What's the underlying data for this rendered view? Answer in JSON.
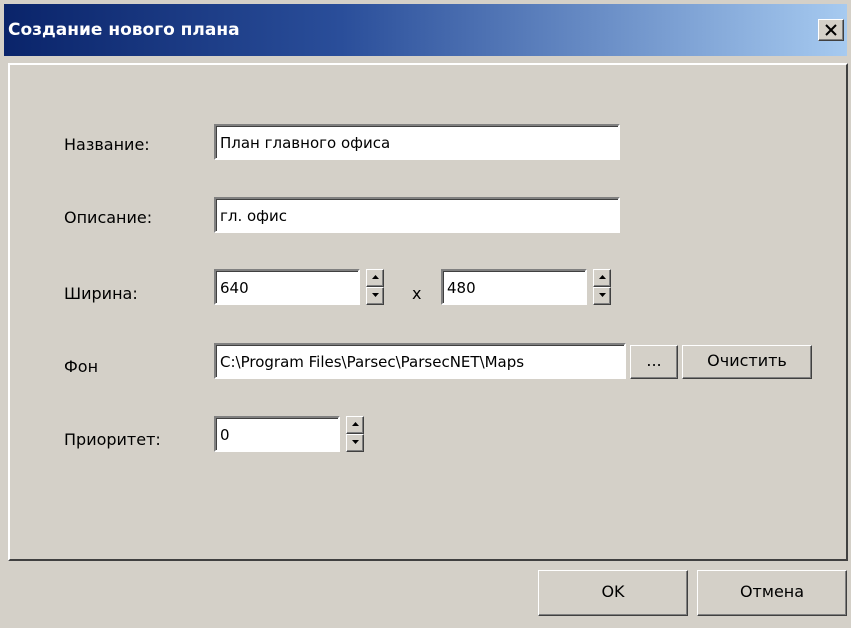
{
  "window": {
    "title": "Создание нового плана"
  },
  "form": {
    "name_label": "Название:",
    "name_value": "План главного офиса",
    "description_label": "Описание:",
    "description_value": "гл. офис",
    "width_label": "Ширина:",
    "width_value": "640",
    "separator": "x",
    "height_value": "480",
    "background_label": "Фон",
    "background_value": "C:\\Program Files\\Parsec\\ParsecNET\\Maps",
    "browse_label": "...",
    "clear_label": "Очистить",
    "priority_label": "Приоритет:",
    "priority_value": "0"
  },
  "footer": {
    "ok_label": "OK",
    "cancel_label": "Отмена"
  }
}
